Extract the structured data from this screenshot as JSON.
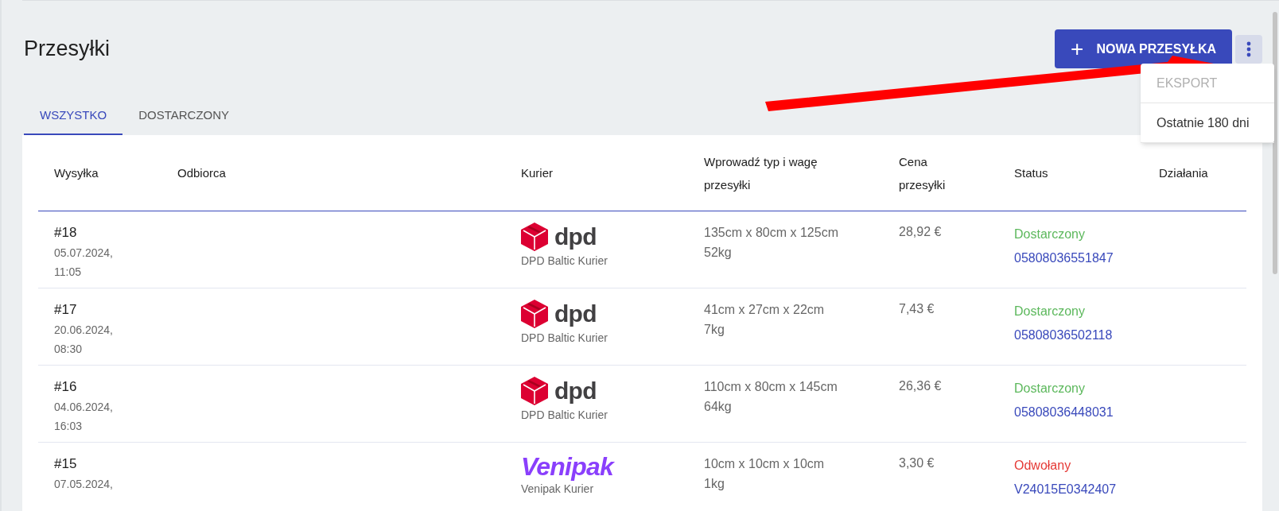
{
  "page": {
    "title": "Przesyłki"
  },
  "new_button": {
    "icon": "+",
    "label": "NOWA PRZESYŁKA"
  },
  "menu": {
    "items": [
      {
        "label": "EKSPORT",
        "disabled": true
      },
      {
        "label": "Ostatnie 180 dni",
        "disabled": false
      }
    ]
  },
  "tabs": [
    {
      "label": "WSZYSTKO",
      "selected": true
    },
    {
      "label": "DOSTARCZONY",
      "selected": false
    }
  ],
  "table": {
    "columns": [
      [
        "Wysyłka"
      ],
      [
        "Odbiorca"
      ],
      [
        "Kurier"
      ],
      [
        "Wprowadź typ i wagę",
        "przesyłki"
      ],
      [
        "Cena",
        "przesyłki"
      ],
      [
        "Status"
      ],
      [
        "Działania"
      ]
    ],
    "rows": [
      {
        "number": "#18",
        "date": "05.07.2024,",
        "time": "11:05",
        "courier": {
          "kind": "dpd",
          "logo": "dpd",
          "name": "DPD Baltic Kurier"
        },
        "dimensions": "135cm x 80cm x 125cm",
        "weight": "52kg",
        "price": "28,92 €",
        "status": {
          "label": "Dostarczony",
          "color": "#5cb85c"
        },
        "tracking": "05808036551847"
      },
      {
        "number": "#17",
        "date": "20.06.2024,",
        "time": "08:30",
        "courier": {
          "kind": "dpd",
          "logo": "dpd",
          "name": "DPD Baltic Kurier"
        },
        "dimensions": "41cm x 27cm x 22cm",
        "weight": "7kg",
        "price": "7,43 €",
        "status": {
          "label": "Dostarczony",
          "color": "#5cb85c"
        },
        "tracking": "05808036502118"
      },
      {
        "number": "#16",
        "date": "04.06.2024,",
        "time": "16:03",
        "courier": {
          "kind": "dpd",
          "logo": "dpd",
          "name": "DPD Baltic Kurier"
        },
        "dimensions": "110cm x 80cm x 145cm",
        "weight": "64kg",
        "price": "26,36 €",
        "status": {
          "label": "Dostarczony",
          "color": "#5cb85c"
        },
        "tracking": "05808036448031"
      },
      {
        "number": "#15",
        "date": "07.05.2024,",
        "courier": {
          "kind": "venipak",
          "logo": "Venipak",
          "name": "Venipak Kurier"
        },
        "dimensions": "10cm x 10cm x 10cm",
        "weight": "1kg",
        "price": "3,30 €",
        "status": {
          "label": "Odwołany",
          "color": "#e53935"
        },
        "tracking": "V24015E0342407"
      }
    ]
  }
}
